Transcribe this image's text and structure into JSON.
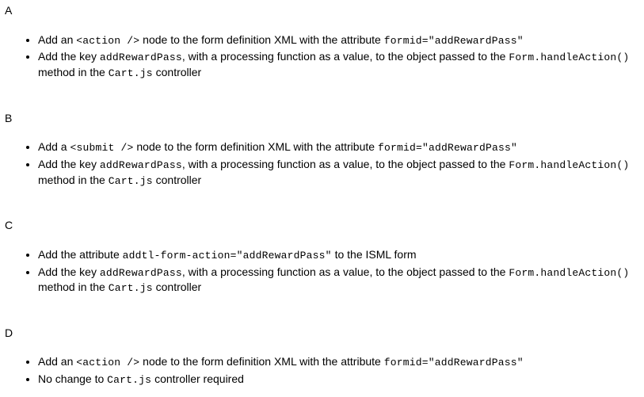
{
  "options": [
    {
      "label": "A",
      "items": [
        [
          {
            "t": "Add an "
          },
          {
            "t": "<action />",
            "code": true
          },
          {
            "t": " node to the form definition XML with the attribute "
          },
          {
            "t": "formid=\"addRewardPass\"",
            "code": true
          }
        ],
        [
          {
            "t": "Add the key "
          },
          {
            "t": "addRewardPass",
            "code": true
          },
          {
            "t": ", with a processing function as a value, to the object passed to the "
          },
          {
            "t": "Form.handleAction()",
            "code": true
          },
          {
            "t": " method in the "
          },
          {
            "t": "Cart.js",
            "code": true
          },
          {
            "t": " controller"
          }
        ]
      ]
    },
    {
      "label": "B",
      "items": [
        [
          {
            "t": "Add a "
          },
          {
            "t": "<submit />",
            "code": true
          },
          {
            "t": " node to the form definition XML with the attribute "
          },
          {
            "t": "formid=\"addRewardPass\"",
            "code": true
          }
        ],
        [
          {
            "t": "Add the key "
          },
          {
            "t": "addRewardPass",
            "code": true
          },
          {
            "t": ", with a processing function as a value, to the object passed to the "
          },
          {
            "t": "Form.handleAction()",
            "code": true
          },
          {
            "t": " method in the "
          },
          {
            "t": "Cart.js",
            "code": true
          },
          {
            "t": " controller"
          }
        ]
      ]
    },
    {
      "label": "C",
      "items": [
        [
          {
            "t": "Add the attribute "
          },
          {
            "t": "addtl-form-action=\"addRewardPass\"",
            "code": true
          },
          {
            "t": " to the ISML form"
          }
        ],
        [
          {
            "t": "Add the key "
          },
          {
            "t": "addRewardPass",
            "code": true
          },
          {
            "t": ", with a processing function as a value, to the object passed to the "
          },
          {
            "t": "Form.handleAction()",
            "code": true
          },
          {
            "t": " method in the "
          },
          {
            "t": "Cart.js",
            "code": true
          },
          {
            "t": " controller"
          }
        ]
      ]
    },
    {
      "label": "D",
      "items": [
        [
          {
            "t": "Add an "
          },
          {
            "t": "<action />",
            "code": true
          },
          {
            "t": " node to the form definition XML with the attribute "
          },
          {
            "t": "formid=\"addRewardPass\"",
            "code": true
          }
        ],
        [
          {
            "t": "No change to "
          },
          {
            "t": "Cart.js",
            "code": true
          },
          {
            "t": " controller required"
          }
        ]
      ]
    }
  ]
}
